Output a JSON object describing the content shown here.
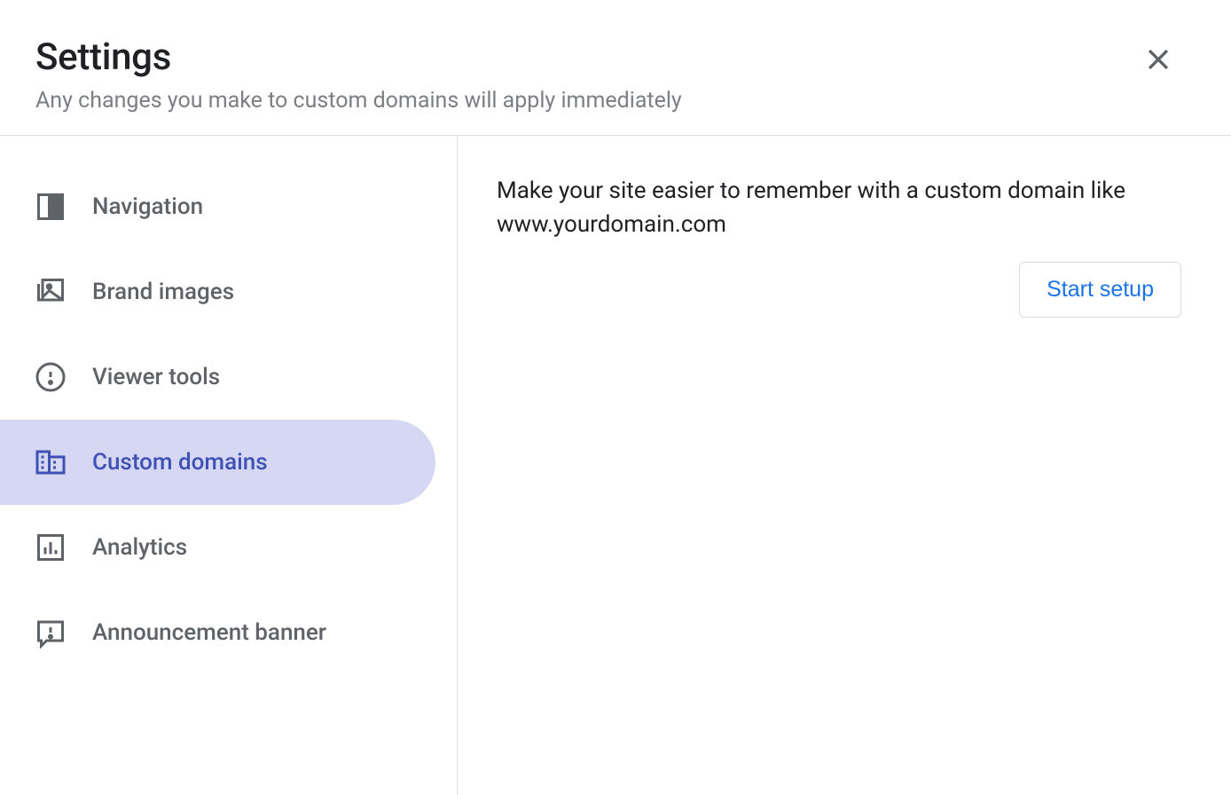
{
  "header": {
    "title": "Settings",
    "subtitle": "Any changes you make to custom domains will apply immediately"
  },
  "sidebar": {
    "items": [
      {
        "label": "Navigation",
        "icon": "navigation-icon"
      },
      {
        "label": "Brand images",
        "icon": "brand-images-icon"
      },
      {
        "label": "Viewer tools",
        "icon": "viewer-tools-icon"
      },
      {
        "label": "Custom domains",
        "icon": "custom-domains-icon"
      },
      {
        "label": "Analytics",
        "icon": "analytics-icon"
      },
      {
        "label": "Announcement banner",
        "icon": "announcement-banner-icon"
      }
    ],
    "active_index": 3
  },
  "content": {
    "description": "Make your site easier to remember with a custom domain like www.yourdomain.com",
    "start_button_label": "Start setup"
  },
  "colors": {
    "active_bg": "#d5d7f3",
    "active_fg": "#3f51b5",
    "button_fg": "#1a73e8",
    "text_primary": "#202124",
    "text_secondary": "#5f6368",
    "annotation_arrow": "#f23a1d"
  }
}
